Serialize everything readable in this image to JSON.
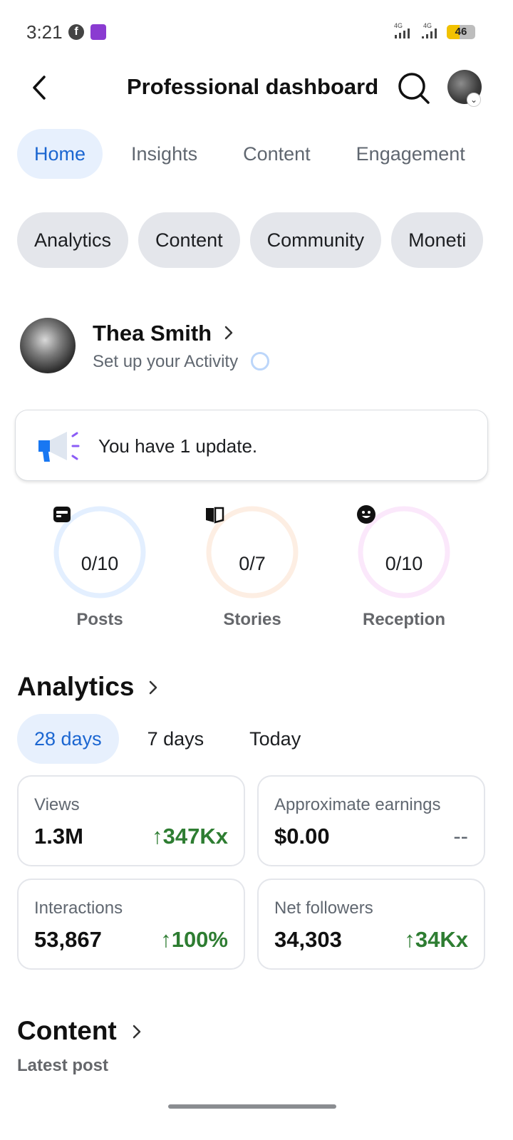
{
  "status_bar": {
    "time": "3:21",
    "signal_1_label": "4G",
    "signal_2_label": "4G",
    "battery_level": "46",
    "battery_fraction": 0.46,
    "battery_color": "#f2c200"
  },
  "header": {
    "title": "Professional dashboard",
    "back_icon": "chevron-left-icon",
    "search_icon": "search-icon"
  },
  "tabs": [
    {
      "label": "Home",
      "active": true
    },
    {
      "label": "Insights",
      "active": false
    },
    {
      "label": "Content",
      "active": false
    },
    {
      "label": "Engagement",
      "active": false
    }
  ],
  "chips": [
    {
      "label": "Analytics"
    },
    {
      "label": "Content"
    },
    {
      "label": "Community"
    },
    {
      "label": "Moneti"
    }
  ],
  "profile": {
    "name": "Thea Smith",
    "subtitle": "Set up your Activity"
  },
  "update": {
    "text": "You have 1 update.",
    "icon": "megaphone-icon"
  },
  "goals": [
    {
      "value": "0/10",
      "label": "Posts",
      "icon": "post-icon",
      "ring_color": "#e3efff"
    },
    {
      "value": "0/7",
      "label": "Stories",
      "icon": "book-icon",
      "ring_color": "#fdeee3"
    },
    {
      "value": "0/10",
      "label": "Reception",
      "icon": "smiley-icon",
      "ring_color": "#fbe8fb"
    }
  ],
  "analytics": {
    "title": "Analytics",
    "periods": [
      {
        "label": "28 days",
        "active": true
      },
      {
        "label": "7 days",
        "active": false
      },
      {
        "label": "Today",
        "active": false
      }
    ],
    "metrics": [
      {
        "label": "Views",
        "value": "1.3M",
        "change": "↑347Kx"
      },
      {
        "label": "Approximate earnings",
        "value": "$0.00",
        "change": "--"
      },
      {
        "label": "Interactions",
        "value": "53,867",
        "change": "↑100%"
      },
      {
        "label": "Net followers",
        "value": "34,303",
        "change": "↑34Kx"
      }
    ]
  },
  "content_section": {
    "title": "Content",
    "subtitle": "Latest post"
  },
  "colors": {
    "accent": "#1b66d1",
    "accent_bg": "#e7f0fd",
    "positive": "#2e7d32"
  }
}
